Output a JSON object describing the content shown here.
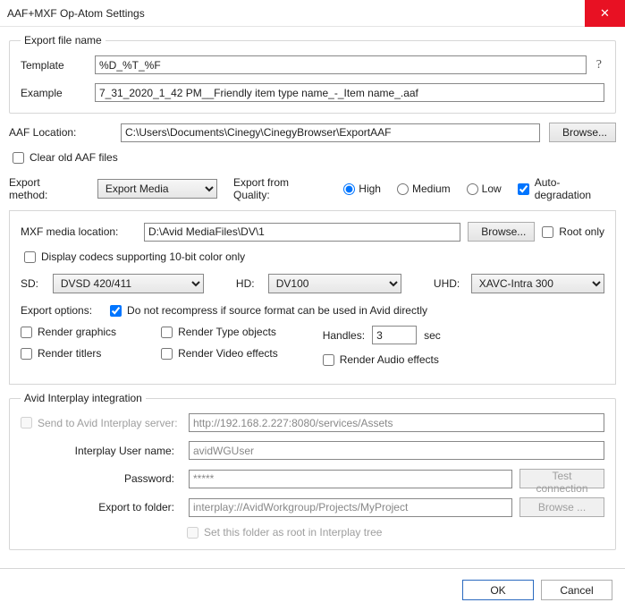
{
  "title": "AAF+MXF Op-Atom Settings",
  "exportFileName": {
    "legend": "Export file name",
    "templateLabel": "Template",
    "templateValue": "%D_%T_%F",
    "help": "?",
    "exampleLabel": "Example",
    "exampleValue": "7_31_2020_1_42 PM__Friendly item type name_-_Item name_.aaf"
  },
  "aaf": {
    "locationLabel": "AAF Location:",
    "locationValue": "C:\\Users\\Documents\\Cinegy\\CinegyBrowser\\ExportAAF",
    "browse": "Browse...",
    "clearOld": "Clear old AAF files"
  },
  "exportMethod": {
    "label": "Export method:",
    "value": "Export Media",
    "qualityLabel": "Export from Quality:",
    "high": "High",
    "medium": "Medium",
    "low": "Low",
    "autoDeg": "Auto-degradation"
  },
  "mxf": {
    "locationLabel": "MXF media location:",
    "locationValue": "D:\\Avid MediaFiles\\DV\\1",
    "browse": "Browse...",
    "rootOnly": "Root only",
    "display10bit": "Display codecs supporting 10-bit color only",
    "sdLabel": "SD:",
    "sdValue": "DVSD 420/411",
    "hdLabel": "HD:",
    "hdValue": "DV100",
    "uhdLabel": "UHD:",
    "uhdValue": "XAVC-Intra 300",
    "exportOptionsLabel": "Export options:",
    "noRecompress": "Do not recompress if source format can be used in Avid directly",
    "renderGraphics": "Render graphics",
    "renderTitlers": "Render titlers",
    "renderType": "Render Type objects",
    "renderVideo": "Render Video effects",
    "renderAudio": "Render Audio effects",
    "handlesLabel": "Handles:",
    "handlesValue": "3",
    "handlesUnit": "sec"
  },
  "interplay": {
    "legend": "Avid Interplay integration",
    "sendTo": "Send to Avid Interplay server:",
    "serverValue": "http://192.168.2.227:8080/services/Assets",
    "userLabel": "Interplay User name:",
    "userValue": "avidWGUser",
    "passLabel": "Password:",
    "passValue": "*****",
    "testConn": "Test connection",
    "exportFolderLabel": "Export to folder:",
    "exportFolderValue": "interplay://AvidWorkgroup/Projects/MyProject",
    "browse": "Browse ...",
    "setAsRoot": "Set this folder as root in Interplay tree"
  },
  "buttons": {
    "ok": "OK",
    "cancel": "Cancel"
  }
}
